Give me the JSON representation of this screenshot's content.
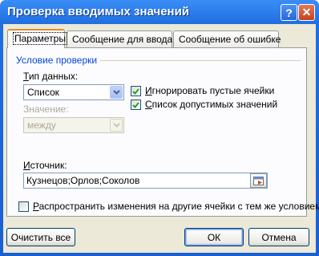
{
  "window": {
    "title": "Проверка вводимых значений",
    "help_glyph": "?",
    "close_glyph": "✕"
  },
  "tabs": [
    {
      "label": "Параметры"
    },
    {
      "label": "Сообщение для ввода"
    },
    {
      "label": "Сообщение об ошибке"
    }
  ],
  "group": {
    "title": "Условие проверки"
  },
  "data_type": {
    "label_u": "Т",
    "label_rest": "ип данных:",
    "value": "Список"
  },
  "value_field": {
    "label": "Значение:",
    "value": "между"
  },
  "checkboxes": {
    "ignore_blank": {
      "label_u": "И",
      "label_rest": "гнорировать пустые ячейки",
      "checked": true
    },
    "in_cell_dropdown": {
      "label_u": "С",
      "label_rest": "писок допустимых значений",
      "checked": true
    },
    "apply_all": {
      "label_u": "Р",
      "label_rest": "аспространить изменения на другие ячейки с тем же условием",
      "checked": false
    }
  },
  "source": {
    "label_u": "И",
    "label_rest": "сточник:",
    "value": "Кузнецов;Орлов;Соколов"
  },
  "buttons": {
    "clear_all": "Очистить все",
    "ok": "ОК",
    "cancel": "Отмена"
  },
  "colors": {
    "titlebar": "#1f6fe0",
    "group_title": "#0046d5",
    "dialog_bg": "#ece9d8"
  }
}
